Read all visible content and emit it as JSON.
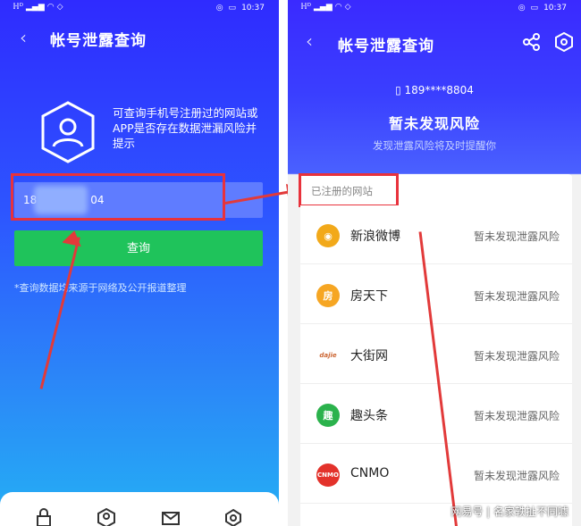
{
  "left": {
    "status_time": "10:37",
    "status_battery": "▮",
    "title": "帐号泄露查询",
    "description": "可查询手机号注册过的网站或APP是否存在数据泄漏风险并提示",
    "phone_value_prefix": "18",
    "phone_value_suffix": "04",
    "query_button": "查询",
    "note": "*查询数据均来源于网络及公开报道整理"
  },
  "right": {
    "status_time": "10:37",
    "title": "帐号泄露查询",
    "phone_number": "189****8804",
    "risk_title": "暂未发现风险",
    "risk_subtitle": "发现泄露风险将及时提醒你",
    "section_label": "已注册的网站",
    "sites": [
      {
        "name": "新浪微博",
        "status": "暂未发现泄露风险",
        "logo_color": "#f2a91a",
        "logo_text": "◉"
      },
      {
        "name": "房天下",
        "status": "暂未发现泄露风险",
        "logo_color": "#f6a623",
        "logo_text": "房"
      },
      {
        "name": "大街网",
        "status": "暂未发现泄露风险",
        "logo_color": "#ffffff",
        "logo_text": "dajie"
      },
      {
        "name": "趣头条",
        "status": "暂未发现泄露风险",
        "logo_color": "#2bb24c",
        "logo_text": "趣"
      },
      {
        "name": "CNMO",
        "status": "暂未发现泄露风险",
        "logo_color": "#e3322b",
        "logo_text": "CNMO"
      }
    ]
  },
  "watermark": "网易号 | 名家轶扯不同噱",
  "colors": {
    "accent_red": "#e8323c",
    "green": "#1fc35b",
    "blue": "#3a3fff"
  }
}
